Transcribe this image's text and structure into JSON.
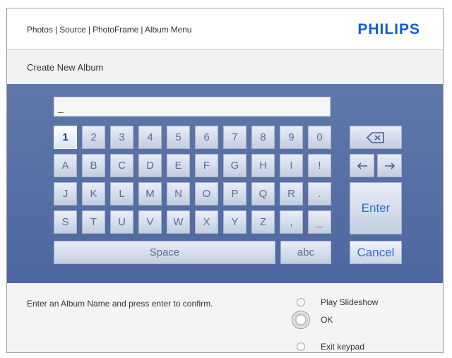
{
  "header": {
    "breadcrumb": "Photos | Source | PhotoFrame | Album Menu",
    "logo": "PHILIPS"
  },
  "title": "Create New Album",
  "input": {
    "value": "_"
  },
  "keyboard": {
    "row1": [
      "1",
      "2",
      "3",
      "4",
      "5",
      "6",
      "7",
      "8",
      "9",
      "0"
    ],
    "row2": [
      "A",
      "B",
      "C",
      "D",
      "E",
      "F",
      "G",
      "H",
      "I",
      "!"
    ],
    "row3": [
      "J",
      "K",
      "L",
      "M",
      "N",
      "O",
      "P",
      "Q",
      "R",
      "."
    ],
    "row4": [
      "S",
      "T",
      "U",
      "V",
      "W",
      "X",
      "Y",
      "Z",
      ",",
      "_"
    ],
    "space": "Space",
    "abc": "abc",
    "enter": "Enter",
    "cancel": "Cancel",
    "selected_key": "1",
    "backspace_icon": "backspace-icon",
    "left_icon": "arrow-left-icon",
    "right_icon": "arrow-right-icon"
  },
  "footer": {
    "hint": "Enter an Album Name and press enter to confirm.",
    "options": [
      {
        "label": "Play Slideshow",
        "selected": false
      },
      {
        "label": "OK",
        "selected": true
      },
      {
        "label": "Exit keypad",
        "selected": false
      }
    ]
  },
  "colors": {
    "brand": "#0b5ed7",
    "keyboard_bg": "#5f78a9",
    "key_text": "#5a6d93",
    "action_text": "#2a6dd0"
  }
}
